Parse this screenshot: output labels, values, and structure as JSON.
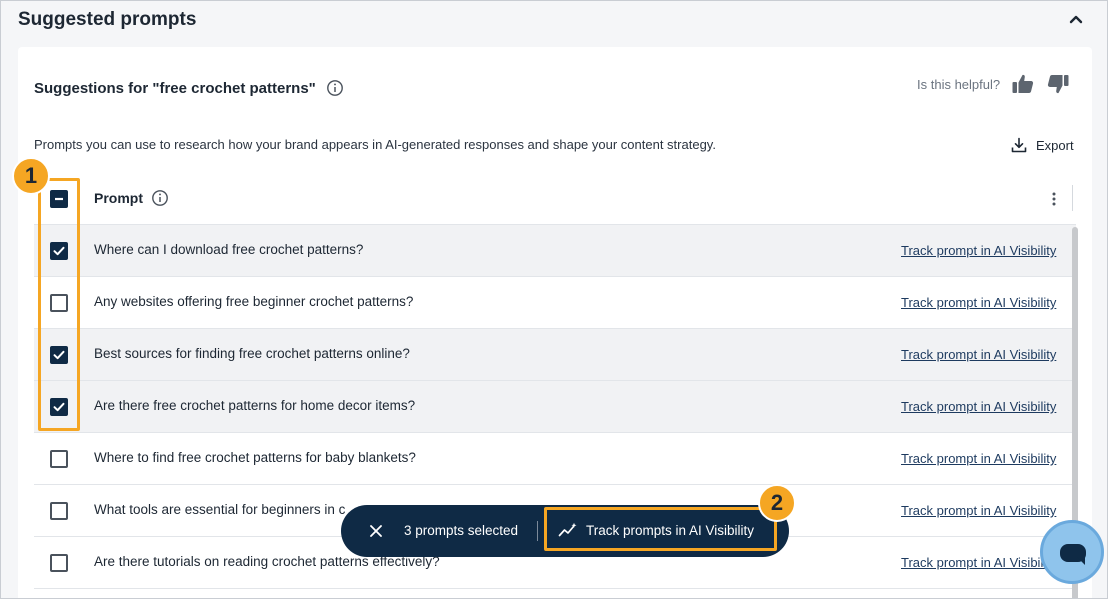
{
  "section": {
    "title": "Suggested prompts"
  },
  "card": {
    "title": "Suggestions for \"free crochet patterns\"",
    "helpful_label": "Is this helpful?",
    "description": "Prompts you can use to research how your brand appears in AI-generated responses and shape your content strategy.",
    "export_label": "Export"
  },
  "table": {
    "header_label": "Prompt",
    "rows": [
      {
        "text": "Where can I download free crochet patterns?",
        "checked": true,
        "link": "Track prompt in AI Visibility"
      },
      {
        "text": "Any websites offering free beginner crochet patterns?",
        "checked": false,
        "link": "Track prompt in AI Visibility"
      },
      {
        "text": "Best sources for finding free crochet patterns online?",
        "checked": true,
        "link": "Track prompt in AI Visibility"
      },
      {
        "text": "Are there free crochet patterns for home decor items?",
        "checked": true,
        "link": "Track prompt in AI Visibility"
      },
      {
        "text": "Where to find free crochet patterns for baby blankets?",
        "checked": false,
        "link": "Track prompt in AI Visibility"
      },
      {
        "text": "What tools are essential for beginners in c",
        "checked": false,
        "link": "Track prompt in AI Visibility"
      },
      {
        "text": "Are there tutorials on reading crochet patterns effectively?",
        "checked": false,
        "link": "Track prompt in AI Visibili"
      }
    ]
  },
  "action_bar": {
    "count_label": "3 prompts selected",
    "track_label": "Track prompts in AI Visibility"
  },
  "annotations": {
    "badge1": "1",
    "badge2": "2"
  },
  "colors": {
    "navy": "#0f2a45",
    "callout": "#f5a623",
    "chat": "#8fc4ec"
  }
}
